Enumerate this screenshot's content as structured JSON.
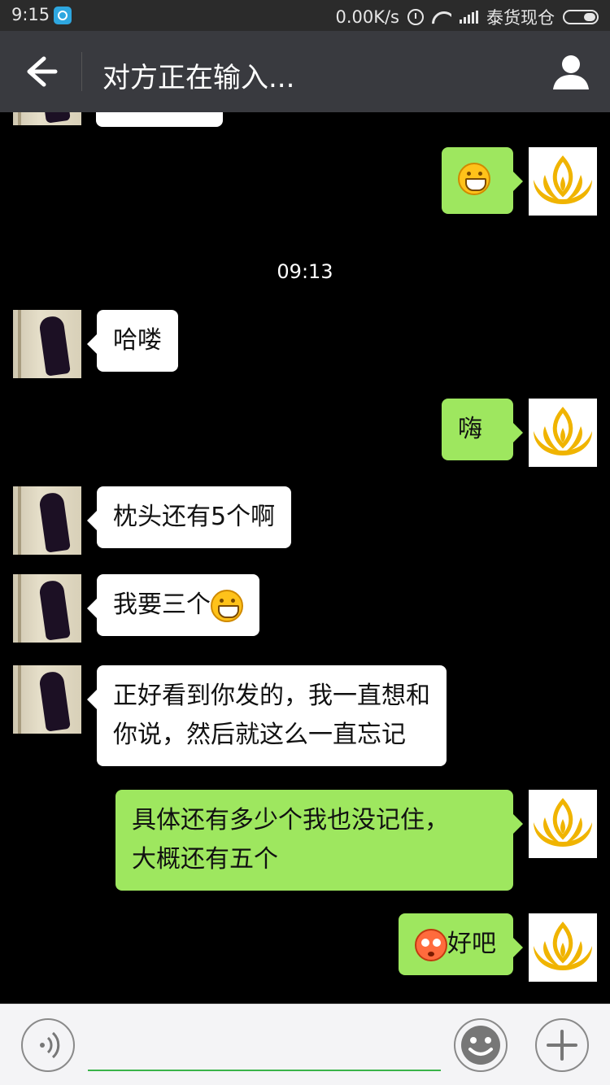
{
  "status_bar": {
    "time": "9:15",
    "network_speed": "0.00K/s",
    "carrier": "泰货现仓",
    "icons": [
      "app-icon",
      "alarm-icon",
      "wifi-icon",
      "signal-icon",
      "battery-icon"
    ]
  },
  "header": {
    "title": "对方正在输入...",
    "back_icon": "arrow-left-icon",
    "profile_icon": "person-icon",
    "background": "#393a3f"
  },
  "chat": {
    "timestamp": "09:13",
    "messages": [
      {
        "sender": "me",
        "emoji": "grin-emoji"
      },
      {
        "sender": "other",
        "text": "哈喽"
      },
      {
        "sender": "me",
        "text": "嗨"
      },
      {
        "sender": "other",
        "text": "枕头还有5个啊"
      },
      {
        "sender": "other",
        "text": "我要三个",
        "emoji": "grin-emoji"
      },
      {
        "sender": "other",
        "lines": [
          "正好看到你发的，我一直想和",
          "你说，然后就这么一直忘记"
        ]
      },
      {
        "sender": "me",
        "lines": [
          "具体还有多少个我也没记住，",
          "大概还有五个"
        ]
      },
      {
        "sender": "me",
        "text": "好吧",
        "emoji": "blush-emoji"
      }
    ],
    "colors": {
      "bubble_me": "#9ee75f",
      "bubble_other": "#ffffff",
      "background": "#000000"
    }
  },
  "input_bar": {
    "voice_icon": "voice-icon",
    "input_value": "",
    "emoji_icon": "smiley-icon",
    "plus_icon": "plus-icon",
    "accent": "#3ab44a"
  }
}
